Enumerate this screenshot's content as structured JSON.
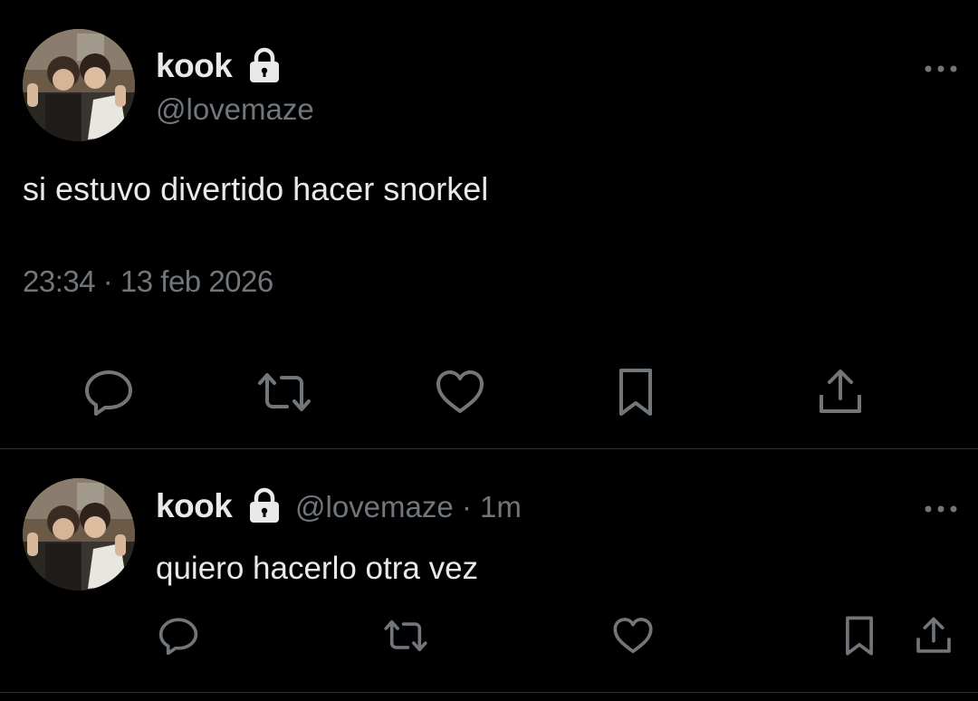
{
  "colors": {
    "background": "#000000",
    "primary_text": "#e7e9ea",
    "secondary_text": "#71767b",
    "divider": "#2f3336"
  },
  "main_tweet": {
    "display_name": "kook",
    "handle": "@lovemaze",
    "text": "si estuvo divertido hacer snorkel",
    "timestamp": "23:34 · 13 feb 2026",
    "icons": [
      "avatar",
      "lock-icon",
      "more-icon",
      "reply-icon",
      "retweet-icon",
      "like-icon",
      "bookmark-icon",
      "share-icon"
    ]
  },
  "reply_tweet": {
    "display_name": "kook",
    "handle_time": "@lovemaze · 1m",
    "text": "quiero hacerlo otra vez",
    "icons": [
      "avatar",
      "lock-icon",
      "more-icon",
      "reply-icon",
      "retweet-icon",
      "like-icon",
      "bookmark-icon",
      "share-icon"
    ]
  }
}
